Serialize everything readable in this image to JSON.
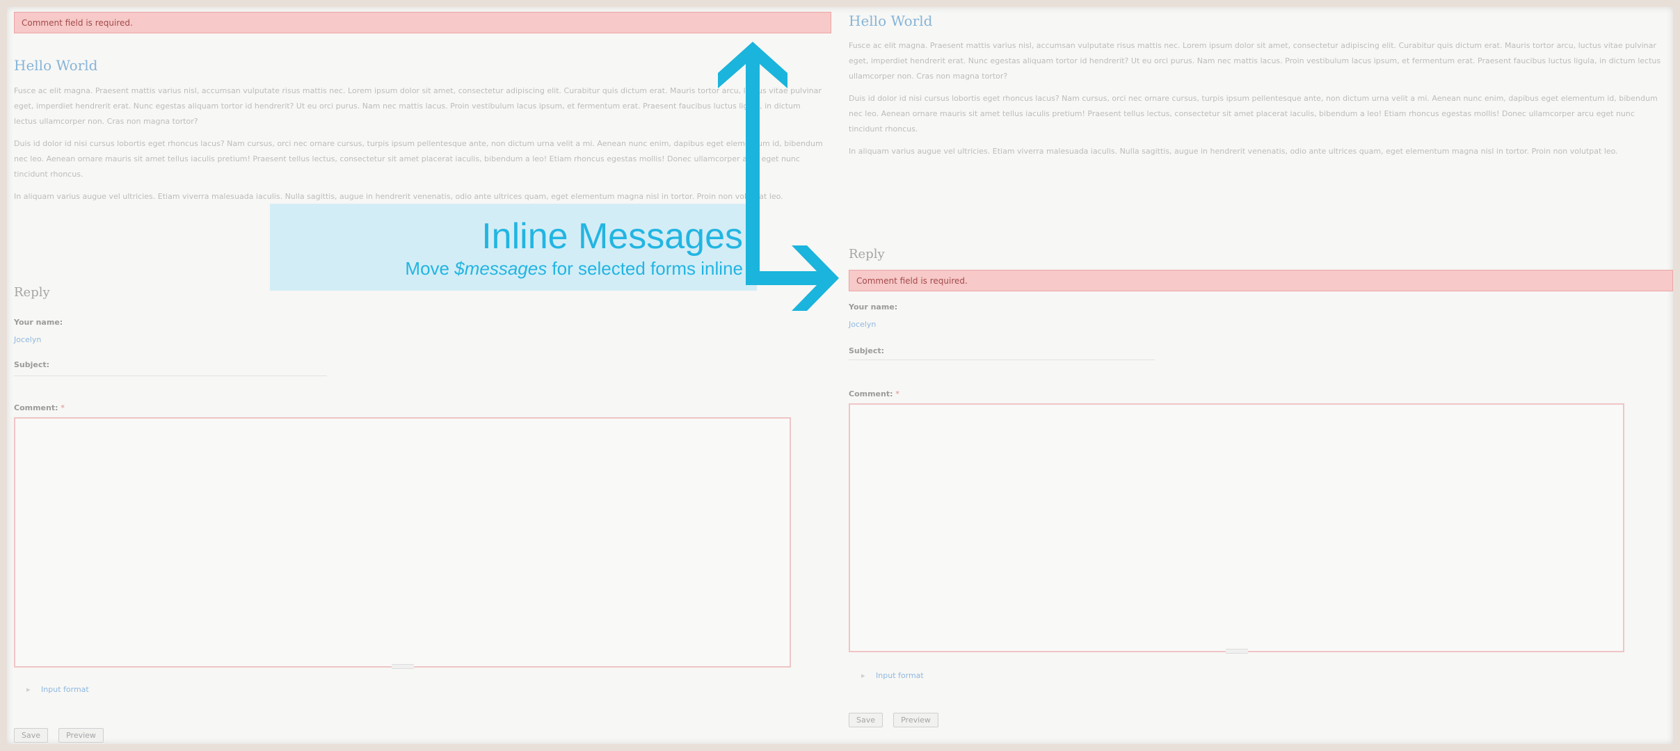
{
  "colors": {
    "error_bg": "#f7c9c9",
    "title": "#86b4d8",
    "accent_arrow": "#1ab4dc"
  },
  "left": {
    "error": "Comment field is required.",
    "title": "Hello World",
    "paragraphs": [
      "Fusce ac elit magna. Praesent mattis varius nisl, accumsan vulputate risus mattis nec. Lorem ipsum dolor sit amet, consectetur adipiscing elit. Curabitur quis dictum erat. Mauris tortor arcu, luctus vitae pulvinar eget, imperdiet hendrerit erat. Nunc egestas aliquam tortor id hendrerit? Ut eu orci purus. Nam nec mattis lacus. Proin vestibulum lacus ipsum, et fermentum erat. Praesent faucibus luctus ligula, in dictum lectus ullamcorper non. Cras non magna tortor?",
      "Duis id dolor id nisi cursus lobortis eget rhoncus lacus? Nam cursus, orci nec ornare cursus, turpis ipsum pellentesque ante, non dictum urna velit a mi. Aenean nunc enim, dapibus eget elementum id, bibendum nec leo. Aenean ornare mauris sit amet tellus iaculis pretium! Praesent tellus lectus, consectetur sit amet placerat iaculis, bibendum a leo! Etiam rhoncus egestas mollis! Donec ullamcorper arcu eget nunc tincidunt rhoncus.",
      "In aliquam varius augue vel ultricies. Etiam viverra malesuada iaculis. Nulla sagittis, augue in hendrerit venenatis, odio ante ultrices quam, eget elementum magna nisl in tortor. Proin non volutpat leo."
    ],
    "reply_heading": "Reply",
    "name_label": "Your name:",
    "name_value": "Jocelyn",
    "subject_label": "Subject:",
    "comment_label": "Comment:",
    "required_mark": "*",
    "input_format": "Input format",
    "save": "Save",
    "preview": "Preview"
  },
  "right": {
    "title": "Hello World",
    "paragraphs": [
      "Fusce ac elit magna. Praesent mattis varius nisl, accumsan vulputate risus mattis nec. Lorem ipsum dolor sit amet, consectetur adipiscing elit. Curabitur quis dictum erat. Mauris tortor arcu, luctus vitae pulvinar eget, imperdiet hendrerit erat. Nunc egestas aliquam tortor id hendrerit? Ut eu orci purus. Nam nec mattis lacus. Proin vestibulum lacus ipsum, et fermentum erat. Praesent faucibus luctus ligula, in dictum lectus ullamcorper non. Cras non magna tortor?",
      "Duis id dolor id nisi cursus lobortis eget rhoncus lacus? Nam cursus, orci nec ornare cursus, turpis ipsum pellentesque ante, non dictum urna velit a mi. Aenean nunc enim, dapibus eget elementum id, bibendum nec leo. Aenean ornare mauris sit amet tellus iaculis pretium! Praesent tellus lectus, consectetur sit amet placerat iaculis, bibendum a leo! Etiam rhoncus egestas mollis! Donec ullamcorper arcu eget nunc tincidunt rhoncus.",
      "In aliquam varius augue vel ultricies. Etiam viverra malesuada iaculis. Nulla sagittis, augue in hendrerit venenatis, odio ante ultrices quam, eget elementum magna nisl in tortor. Proin non volutpat leo."
    ],
    "reply_heading": "Reply",
    "error": "Comment field is required.",
    "name_label": "Your name:",
    "name_value": "Jocelyn",
    "subject_label": "Subject:",
    "comment_label": "Comment:",
    "required_mark": "*",
    "input_format": "Input format",
    "save": "Save",
    "preview": "Preview"
  },
  "callout": {
    "title": "Inline Messages",
    "subtitle_pre": "Move ",
    "subtitle_var": "$messages",
    "subtitle_post": " for selected forms inline"
  }
}
